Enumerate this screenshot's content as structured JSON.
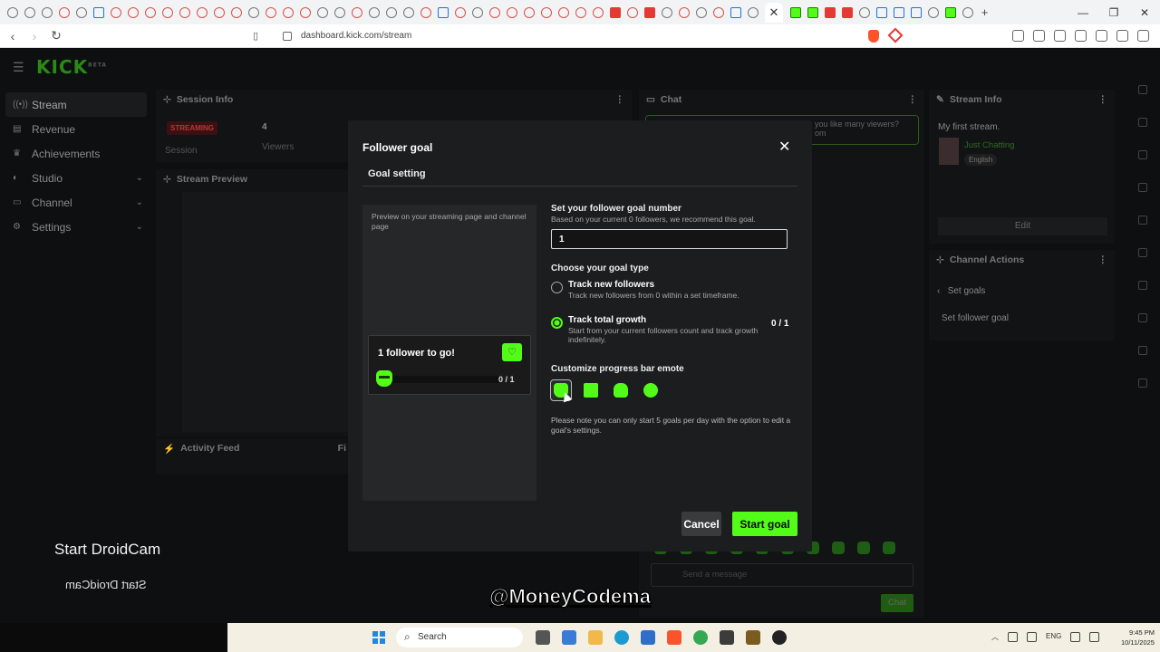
{
  "browser": {
    "url": "dashboard.kick.com/stream",
    "active_tab_close": "✕"
  },
  "app": {
    "logo": "KICK",
    "logo_tag": "BETA",
    "sidebar": [
      {
        "label": "Stream",
        "icon": "stream-icon"
      },
      {
        "label": "Revenue",
        "icon": "revenue-icon"
      },
      {
        "label": "Achievements",
        "icon": "trophy-icon"
      },
      {
        "label": "Studio",
        "icon": "studio-icon"
      },
      {
        "label": "Channel",
        "icon": "channel-icon"
      },
      {
        "label": "Settings",
        "icon": "gear-icon"
      }
    ],
    "session_info": {
      "title": "Session Info",
      "status": "STREAMING",
      "status_sub": "Session",
      "viewers_count": "4",
      "viewers_label": "Viewers"
    },
    "stream_preview_title": "Stream Preview",
    "activity_feed_title": "Activity Feed",
    "activity_feed_filter": "Fi",
    "chat": {
      "title": "Chat",
      "notice_1": "you like many viewers?",
      "notice_2": "om",
      "input_placeholder": "Send a message",
      "send_label": "Chat"
    },
    "stream_info": {
      "title": "Stream Info",
      "stream_title": "My first stream.",
      "category": "Just Chatting",
      "language": "English",
      "edit_label": "Edit"
    },
    "channel_actions": {
      "title": "Channel Actions",
      "back_label": "Set goals",
      "item": "Set follower goal"
    }
  },
  "modal": {
    "title": "Follower goal",
    "tab": "Goal setting",
    "preview_text": "Preview on your streaming page and channel page",
    "preview_card": {
      "title": "1 follower to go!",
      "progress": "0 / 1"
    },
    "goal_number": {
      "label": "Set your follower goal number",
      "sub": "Based on your current 0 followers, we recommend this goal.",
      "value": "1"
    },
    "goal_type": {
      "label": "Choose your goal type",
      "options": [
        {
          "title": "Track new followers",
          "desc": "Track new followers from 0 within a set timeframe.",
          "selected": false
        },
        {
          "title": "Track total growth",
          "desc": "Start from your current followers count and track growth indefinitely.",
          "selected": true,
          "ratio": "0 / 1"
        }
      ]
    },
    "emote": {
      "label": "Customize progress bar emote",
      "selected_index": 0
    },
    "note": "Please note you can only start 5 goals per day with the option to edit a goal's settings.",
    "cancel_label": "Cancel",
    "start_label": "Start goal",
    "accent_color": "#53fc18"
  },
  "overlay": {
    "droidcam": "Start DroidCam",
    "droidcam_mirror": "Start DroidCam",
    "watermark": "@MoneyCodema"
  },
  "taskbar": {
    "search_label": "Search",
    "lang": "ENG",
    "time": "9:45 PM",
    "date": "10/11/2025"
  }
}
